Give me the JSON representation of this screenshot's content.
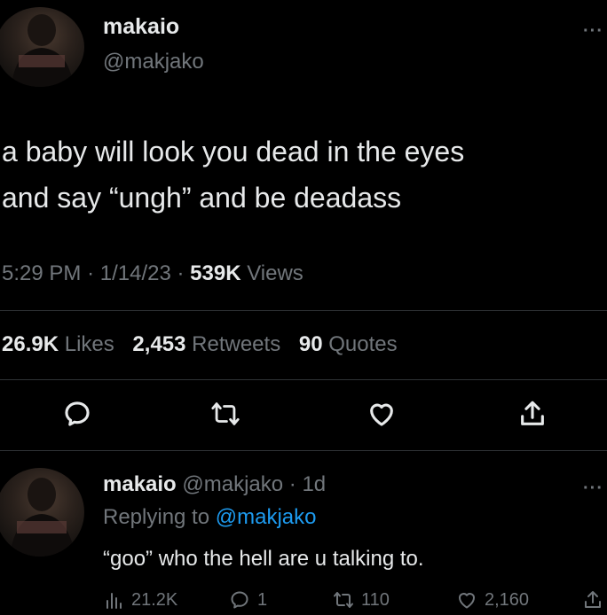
{
  "tweet": {
    "author_name": "makaio",
    "author_handle": "@makjako",
    "more": "···",
    "text_line1": "a baby will look you dead in the eyes",
    "text_line2": "and say “ungh” and be deadass",
    "time": "5:29 PM",
    "date": "1/14/23",
    "views_count": "539K",
    "views_label": "Views",
    "sep": "·",
    "likes_count": "26.9K",
    "likes_label": "Likes",
    "retweets_count": "2,453",
    "retweets_label": "Retweets",
    "quotes_count": "90",
    "quotes_label": "Quotes",
    "actions": [
      "reply-icon",
      "retweet-icon",
      "like-icon",
      "share-icon"
    ]
  },
  "reply": {
    "author_name": "makaio",
    "author_handle": "@makjako",
    "age": "1d",
    "replying_label": "Replying to",
    "replying_to": "@makjako",
    "text": "“goo” who the hell are u talking to.",
    "views": "21.2K",
    "replies": "1",
    "retweets": "110",
    "likes": "2,160",
    "more": "···"
  },
  "colors": {
    "background": "#000000",
    "text": "#e7e9ea",
    "muted": "#71767b",
    "link": "#1d9bf0",
    "divider": "#2f3336"
  }
}
